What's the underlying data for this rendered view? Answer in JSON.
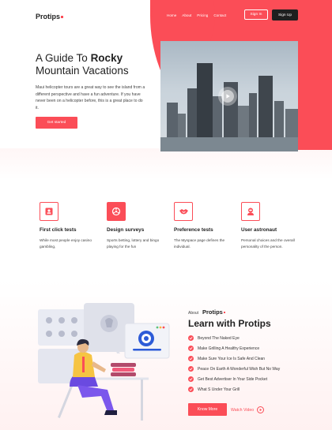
{
  "brand": {
    "name": "Protips",
    "accent": "#fb4d57",
    "dark": "#1f1f1f"
  },
  "nav": {
    "links": [
      "Home",
      "About",
      "Pricing",
      "Contact"
    ],
    "signin_label": "Sign In",
    "signup_label": "Sign Up"
  },
  "hero": {
    "title_start": "A Guide To ",
    "title_bold": "Rocky",
    "title_end": "Mountain Vacations",
    "text": "Maui helicopter tours are a great way to see the island from a different perspective and have a fun adventure. If you have never been on a helicopter before, this is a great place to do it.",
    "cta_label": "Get started",
    "image_icon": "city-skyline-photo",
    "play_icon": "play-icon"
  },
  "features": [
    {
      "title": "First click tests",
      "text": "While most people enjoy casino gambling,",
      "icon": "id-card-icon",
      "style": "outline"
    },
    {
      "title": "Design surveys",
      "text": "Sports betting, lottery and bingo playing for the fun",
      "icon": "biohazard-icon",
      "style": "filled"
    },
    {
      "title": "Preference tests",
      "text": "The Myspace page defines the individual.",
      "icon": "handshake-icon",
      "style": "outline"
    },
    {
      "title": "User astronaut",
      "text": "Personal choices and the overall personality of the person.",
      "icon": "astronaut-icon",
      "style": "outline"
    }
  ],
  "about": {
    "label": "About",
    "brand": "Protips",
    "title": "Learn with Protips",
    "items": [
      "Beyond The Naked Eye",
      "Make Grilling A Healthy Experience",
      "Make Sure Your Ice Is Safe And Clean",
      "Peace On Earth A Wonderful Wish But No Way",
      "Get Best Advertiser In Your Side Pocket",
      "What S Under Your Grill"
    ],
    "more_label": "Know More",
    "watch_label": "Watch Video",
    "illustration": "person-at-desk-illustration"
  }
}
